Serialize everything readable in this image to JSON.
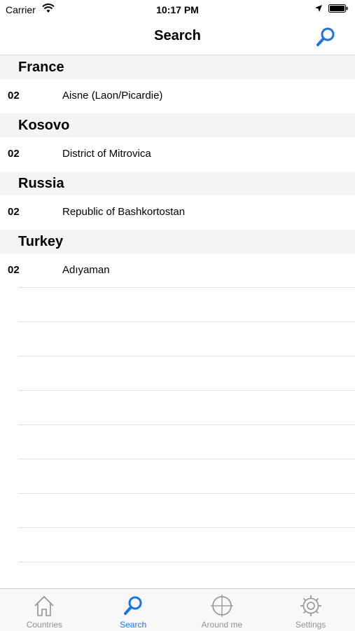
{
  "status_bar": {
    "carrier": "Carrier",
    "time": "10:17 PM"
  },
  "nav": {
    "title": "Search",
    "search_icon": "search-icon"
  },
  "sections": [
    {
      "country": "France",
      "rows": [
        {
          "code": "02",
          "name": "Aisne (Laon/Picardie)"
        }
      ]
    },
    {
      "country": "Kosovo",
      "rows": [
        {
          "code": "02",
          "name": "District of Mitrovica"
        }
      ]
    },
    {
      "country": "Russia",
      "rows": [
        {
          "code": "02",
          "name": "Republic of Bashkortostan"
        }
      ]
    },
    {
      "country": "Turkey",
      "rows": [
        {
          "code": "02",
          "name": "Adıyaman"
        }
      ]
    }
  ],
  "tabs": [
    {
      "label": "Countries",
      "icon": "house-icon",
      "active": false
    },
    {
      "label": "Search",
      "icon": "search-icon",
      "active": true
    },
    {
      "label": "Around me",
      "icon": "crosshair-icon",
      "active": false
    },
    {
      "label": "Settings",
      "icon": "gear-icon",
      "active": false
    }
  ],
  "colors": {
    "accent": "#1a73e8",
    "inactive": "#929292",
    "section_bg": "#f4f4f5"
  }
}
